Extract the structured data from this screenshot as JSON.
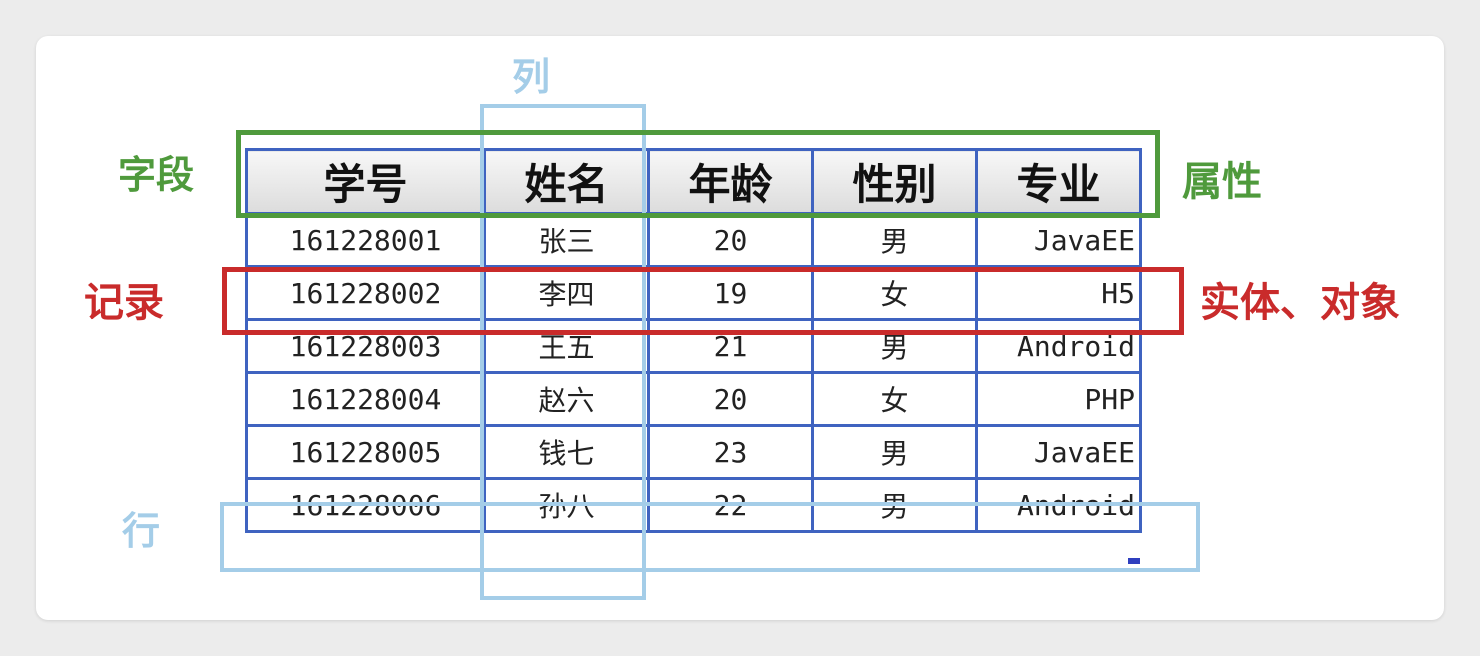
{
  "labels": {
    "column": "列",
    "row": "行",
    "field": "字段",
    "attribute": "属性",
    "record": "记录",
    "entity_object": "实体、对象"
  },
  "colors": {
    "column_row": "#a4cde8",
    "field_attribute": "#4f9a3c",
    "record_entity": "#c92b2b",
    "grid": "#3f63c0"
  },
  "table": {
    "headers": [
      "学号",
      "姓名",
      "年龄",
      "性别",
      "专业"
    ],
    "rows": [
      [
        "161228001",
        "张三",
        "20",
        "男",
        "JavaEE"
      ],
      [
        "161228002",
        "李四",
        "19",
        "女",
        "H5"
      ],
      [
        "161228003",
        "王五",
        "21",
        "男",
        "Android"
      ],
      [
        "161228004",
        "赵六",
        "20",
        "女",
        "PHP"
      ],
      [
        "161228005",
        "钱七",
        "23",
        "男",
        "JavaEE"
      ],
      [
        "161228006",
        "孙八",
        "22",
        "男",
        "Android"
      ]
    ]
  }
}
